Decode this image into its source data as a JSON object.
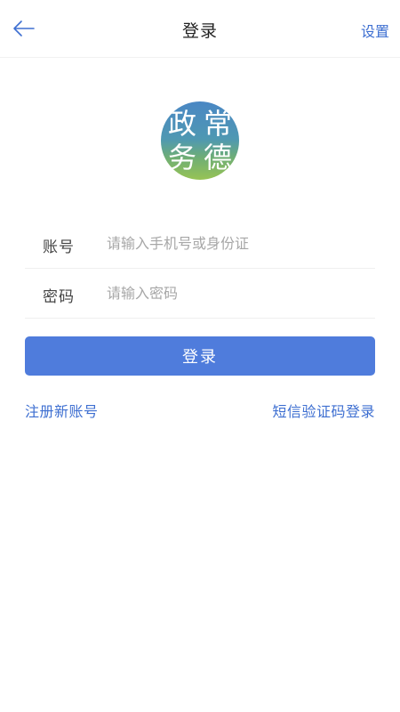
{
  "header": {
    "title": "登录",
    "settings_label": "设置",
    "back_icon": "arrow-left-icon"
  },
  "logo": {
    "chars": [
      "政",
      "常",
      "务",
      "德"
    ]
  },
  "form": {
    "account": {
      "label": "账号",
      "placeholder": "请输入手机号或身份证",
      "value": ""
    },
    "password": {
      "label": "密码",
      "placeholder": "请输入密码",
      "value": ""
    }
  },
  "actions": {
    "login_label": "登录",
    "register_label": "注册新账号",
    "sms_login_label": "短信验证码登录"
  },
  "colors": {
    "primary": "#4f7cdc",
    "link": "#3e6fd1",
    "background": "#ffffff"
  }
}
